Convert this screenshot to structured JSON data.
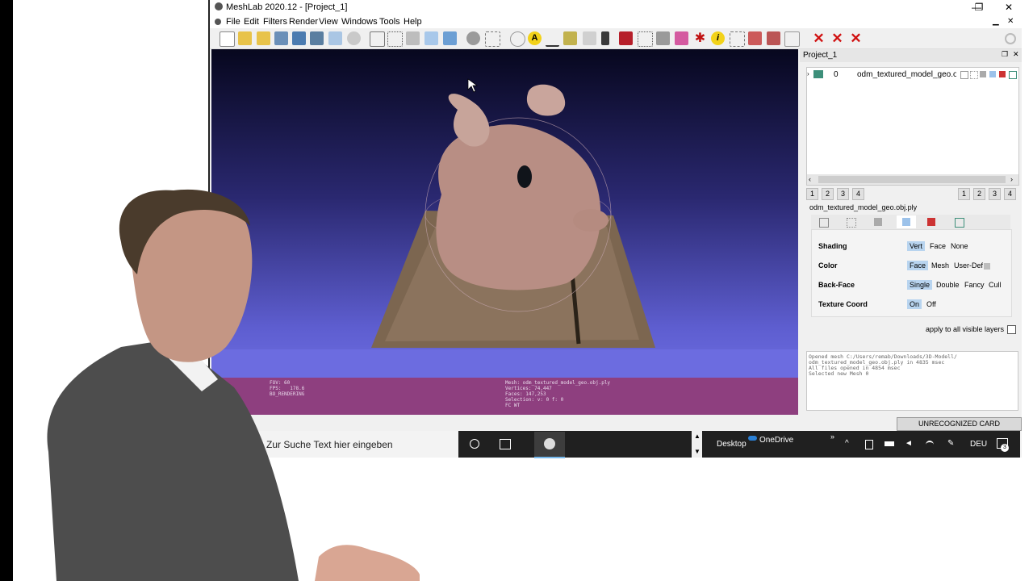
{
  "window": {
    "title": "MeshLab 2020.12 - [Project_1]",
    "controls": {
      "minimize": "—",
      "restore": "❐",
      "close": "✕"
    }
  },
  "menu": [
    "File",
    "Edit",
    "Filters",
    "Render",
    "View",
    "Windows",
    "Tools",
    "Help"
  ],
  "viewport": {
    "info_left": "FOV: 60\nFPS:   178.6\nBO_RENDERING",
    "info_right": "Mesh: odm_textured_model_geo.obj.ply\nVertices: 74,447\nFaces: 147,253\nSelection: v: 0 f: 0\nFC WT"
  },
  "project": {
    "title": "Project_1",
    "layer": {
      "index": "0",
      "name": "odm_textured_model_geo.obj"
    },
    "left_numbers": [
      "1",
      "2",
      "3",
      "4"
    ],
    "right_numbers": [
      "1",
      "2",
      "3",
      "4"
    ],
    "mesh_label": "odm_textured_model_geo.obj.ply"
  },
  "render_props": {
    "shading": {
      "label": "Shading",
      "options": [
        "Vert",
        "Face",
        "None"
      ],
      "selected": "Vert"
    },
    "color": {
      "label": "Color",
      "options": [
        "Face",
        "Mesh",
        "User-Def"
      ],
      "selected": "Face"
    },
    "backface": {
      "label": "Back-Face",
      "options": [
        "Single",
        "Double",
        "Fancy",
        "Cull"
      ],
      "selected": "Single"
    },
    "texcoord": {
      "label": "Texture Coord",
      "options": [
        "On",
        "Off"
      ],
      "selected": "On"
    },
    "apply_all": "apply to all visible layers"
  },
  "log": "Opened mesh C:/Users/remab/Downloads/3D-Modell/\nodm_textured_model_geo.obj.ply in 4835 msec\nAll files opened in 4854 msec\nSelected new Mesh 0",
  "status": {
    "card": "UNRECOGNIZED CARD"
  },
  "taskbar": {
    "search_placeholder": "Zur Suche Text hier eingeben",
    "desktop": "Desktop",
    "onedrive": "OneDrive",
    "lang": "DEU",
    "notif_count": "3"
  },
  "colors": {
    "viewport_top": "#07071e",
    "viewport_bottom": "#6c6ce0",
    "info_bar": "#8e3f7f",
    "selected_option": "#b8d4ef"
  }
}
